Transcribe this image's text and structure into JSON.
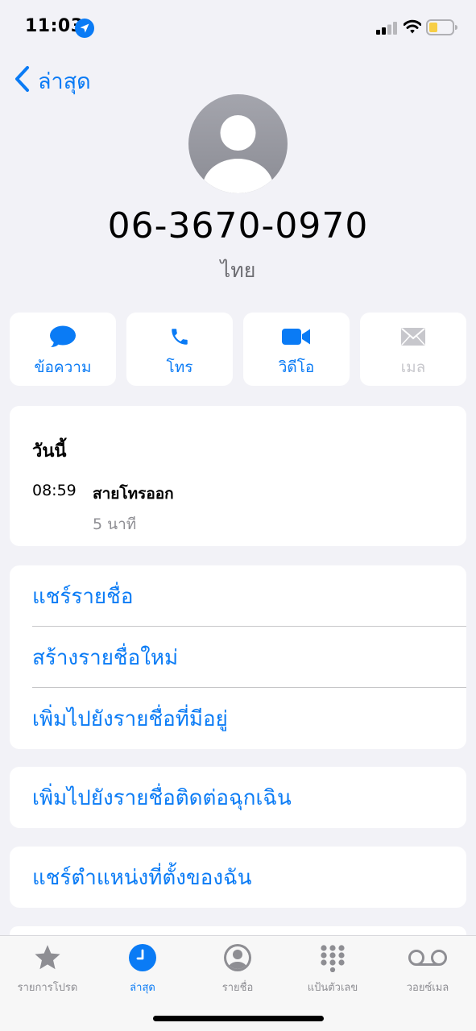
{
  "status_bar": {
    "time": "11:03",
    "icons": [
      "location-arrow-icon",
      "cellular-signal-icon",
      "wifi-icon",
      "battery-low-icon"
    ]
  },
  "nav": {
    "back_label": "ล่าสุด",
    "back_icon": "chevron-left-icon"
  },
  "contact": {
    "avatar_icon": "person-placeholder-icon",
    "phone_number": "06-3670-0970",
    "phone_label": "ไทย"
  },
  "actions": [
    {
      "label": "ข้อความ",
      "icon": "message-bubble-icon",
      "enabled": true
    },
    {
      "label": "โทร",
      "icon": "phone-icon",
      "enabled": true
    },
    {
      "label": "วิดีโอ",
      "icon": "video-camera-icon",
      "enabled": true
    },
    {
      "label": "เมล",
      "icon": "envelope-icon",
      "enabled": false
    }
  ],
  "recent": {
    "day": "วันนี้",
    "call_time": "08:59",
    "call_type": "สายโทรออก",
    "duration": "5 นาที"
  },
  "options": [
    "แชร์รายชื่อ",
    "สร้างรายชื่อใหม่",
    "เพิ่มไปยังรายชื่อที่มีอยู่"
  ],
  "emergency_option": "เพิ่มไปยังรายชื่อติดต่อฉุกเฉิน",
  "share_location_option": "แชร์ตำแหน่งที่ตั้งของฉัน",
  "tabs": [
    {
      "label": "รายการโปรด",
      "icon": "star-icon",
      "active": false
    },
    {
      "label": "ล่าสุด",
      "icon": "clock-icon",
      "active": true
    },
    {
      "label": "รายชื่อ",
      "icon": "person-circle-icon",
      "active": false
    },
    {
      "label": "แป้นตัวเลข",
      "icon": "keypad-icon",
      "active": false
    },
    {
      "label": "วอยซ์เมล",
      "icon": "voicemail-icon",
      "active": false
    }
  ],
  "colors": {
    "accent": "#0a7bf5",
    "background": "#f2f2f7",
    "card": "#ffffff",
    "secondary_text": "#8e8e93",
    "disabled": "#c7c7cc",
    "avatar_gray": "#9a9ba3",
    "battery_yellow": "#f7ce46"
  }
}
